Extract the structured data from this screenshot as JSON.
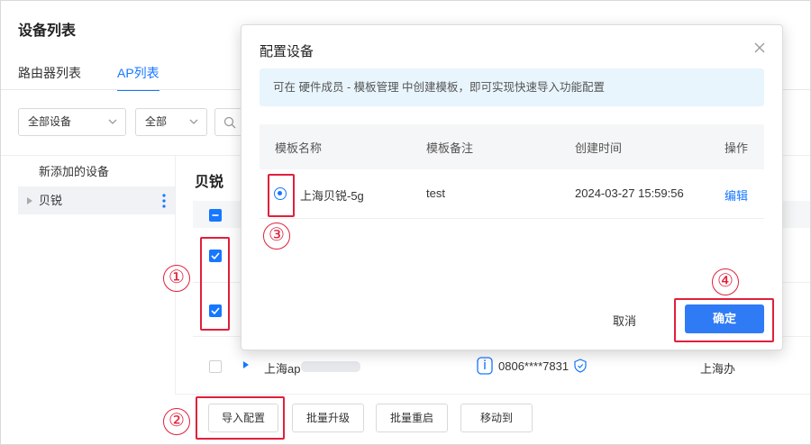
{
  "page": {
    "title": "设备列表"
  },
  "tabs": [
    {
      "label": "路由器列表",
      "active": false
    },
    {
      "label": "AP列表",
      "active": true
    }
  ],
  "filters": {
    "device_select": "全部设备",
    "status_select": "全部"
  },
  "tree": {
    "items": [
      {
        "label": "新添加的设备"
      },
      {
        "label": "贝锐"
      }
    ]
  },
  "section": {
    "title": "贝锐"
  },
  "ap_row": {
    "name_prefix": "上海ap",
    "serial": "0806****7831",
    "location": "上海办"
  },
  "bottom_actions": {
    "import": "导入配置",
    "batch_upgrade": "批量升级",
    "batch_restart": "批量重启",
    "move_to": "移动到"
  },
  "modal": {
    "title": "配置设备",
    "info": "可在 硬件成员 - 模板管理 中创建模板，即可实现快速导入功能配置",
    "columns": [
      "模板名称",
      "模板备注",
      "创建时间",
      "操作"
    ],
    "rows": [
      {
        "name": "上海贝锐-5g",
        "note": "test",
        "created": "2024-03-27 15:59:56",
        "action": "编辑"
      }
    ],
    "cancel": "取消",
    "confirm": "确定"
  },
  "annotations": [
    "①",
    "②",
    "③",
    "④"
  ],
  "colors": {
    "accent": "#1677ff",
    "annotation": "#e0203c",
    "primary_button": "#2f7bf5",
    "info_bg": "#e9f5fd"
  }
}
